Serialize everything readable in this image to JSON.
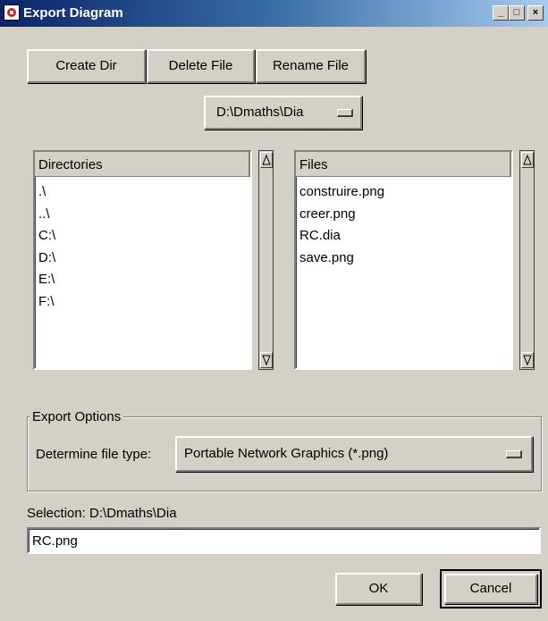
{
  "window": {
    "title": "Export Diagram",
    "controls": {
      "minimize": "_",
      "maximize": "□",
      "close": "×"
    }
  },
  "toolbar": {
    "create_dir": "Create Dir",
    "delete_file": "Delete File",
    "rename_file": "Rename File"
  },
  "path_menu": {
    "value": "D:\\Dmaths\\Dia"
  },
  "directories": {
    "header": "Directories",
    "items": [
      ".\\",
      "..\\",
      "C:\\",
      "D:\\",
      "E:\\",
      "F:\\"
    ]
  },
  "files": {
    "header": "Files",
    "items": [
      "construire.png",
      "creer.png",
      "RC.dia",
      "save.png"
    ]
  },
  "export_options": {
    "legend": "Export Options",
    "file_type_label": "Determine file type:",
    "file_type_value": "Portable Network Graphics (*.png)"
  },
  "selection": {
    "label": "Selection: D:\\Dmaths\\Dia",
    "value": "RC.png"
  },
  "actions": {
    "ok": "OK",
    "cancel": "Cancel"
  },
  "colors": {
    "titlebar_start": "#0a246a",
    "titlebar_end": "#a6caf0",
    "face": "#d4d0c8"
  }
}
